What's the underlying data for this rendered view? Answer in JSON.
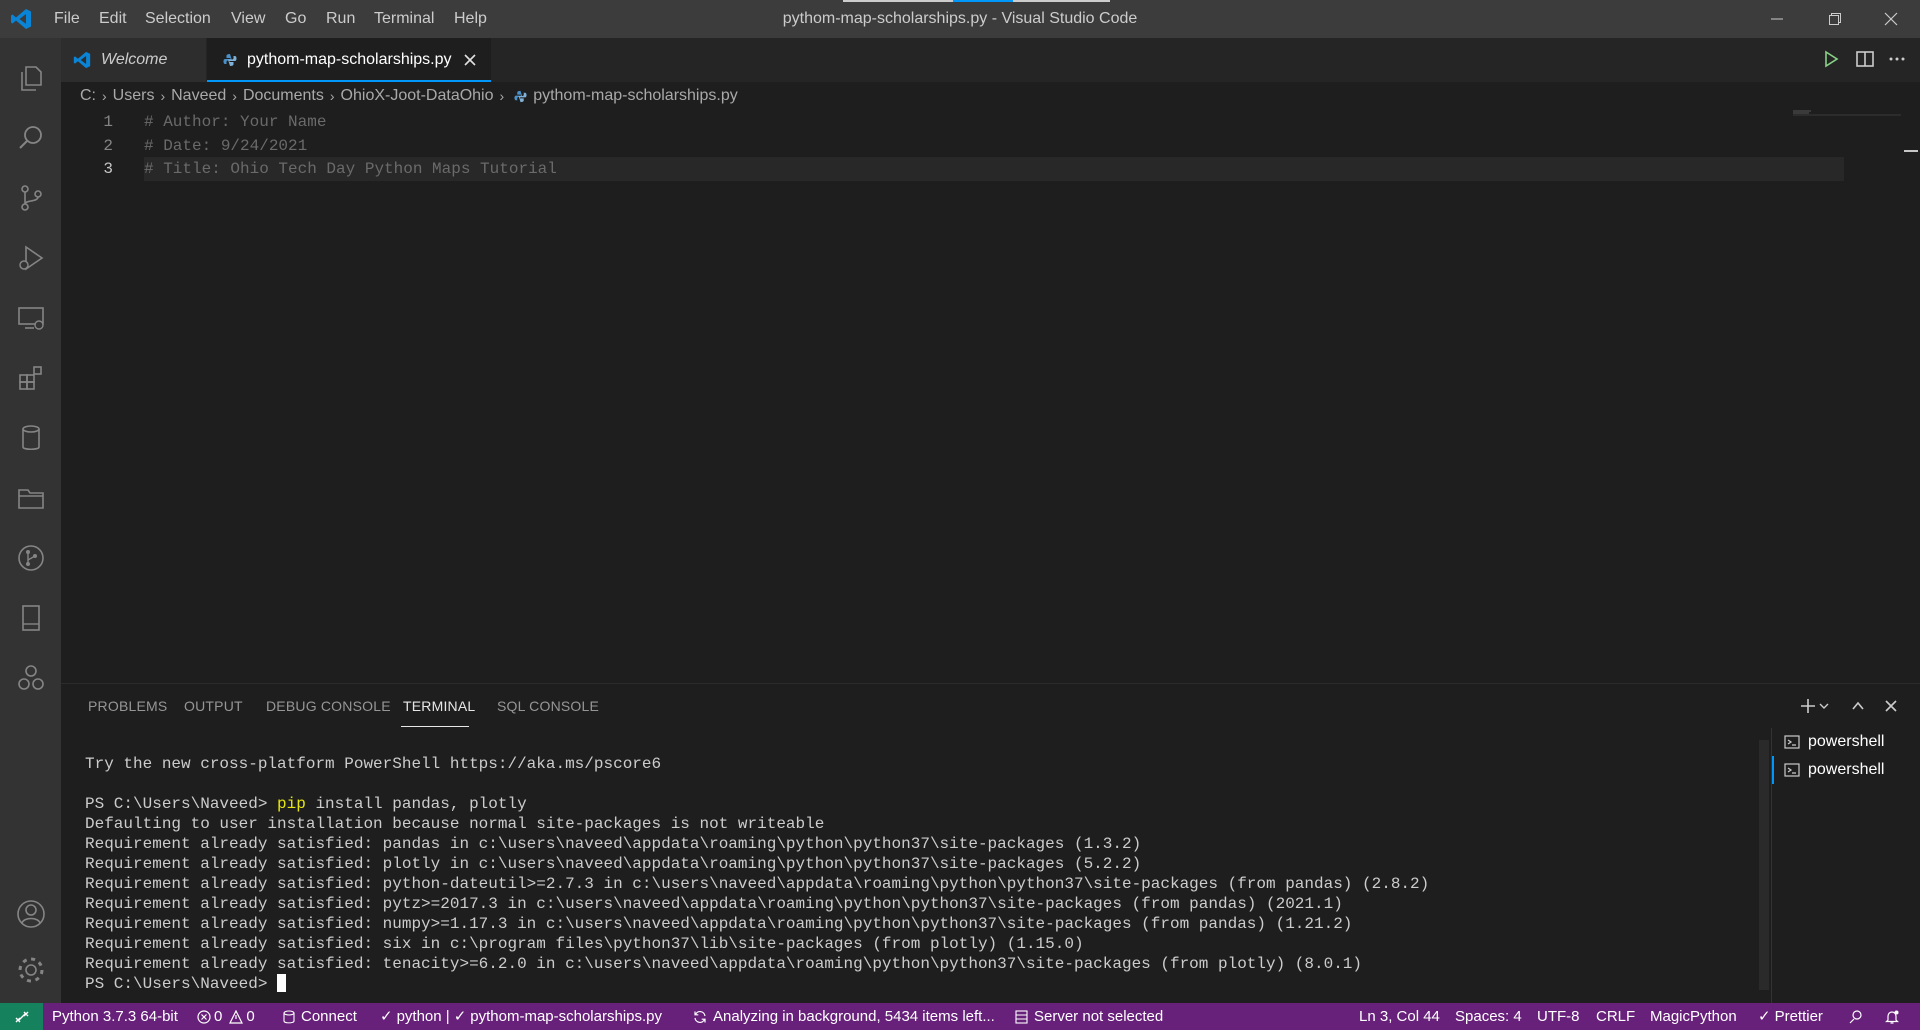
{
  "window": {
    "title": "pythom-map-scholarships.py - Visual Studio Code",
    "menu": [
      "File",
      "Edit",
      "Selection",
      "View",
      "Go",
      "Run",
      "Terminal",
      "Help"
    ]
  },
  "activity_bar": {
    "icons": [
      "files-icon",
      "search-icon",
      "source-control-icon",
      "run-debug-icon",
      "remote-explorer-icon",
      "extensions-icon",
      "database-icon",
      "folder-icon",
      "git-graph-icon",
      "notebook-icon",
      "live-share-icon"
    ],
    "bottom_icons": [
      "account-icon",
      "settings-gear-icon"
    ]
  },
  "tabs": {
    "welcome": "Welcome",
    "active": "pythom-map-scholarships.py"
  },
  "breadcrumbs": [
    "C:",
    "Users",
    "Naveed",
    "Documents",
    "OhioX-Joot-DataOhio",
    "pythom-map-scholarships.py"
  ],
  "editor": {
    "lines": [
      {
        "num": "1",
        "text": "# Author: Your Name"
      },
      {
        "num": "2",
        "text": "# Date: 9/24/2021"
      },
      {
        "num": "3",
        "text": "# Title: Ohio Tech Day Python Maps Tutorial"
      }
    ]
  },
  "panel": {
    "tabs": [
      "PROBLEMS",
      "OUTPUT",
      "DEBUG CONSOLE",
      "TERMINAL",
      "SQL CONSOLE"
    ],
    "active_tab": "TERMINAL",
    "terminals": [
      "powershell",
      "powershell"
    ],
    "terminal_lines": {
      "l1": "Try the new cross-platform PowerShell https://aka.ms/pscore6",
      "prompt1": "PS C:\\Users\\Naveed> ",
      "cmd_pip": "pip",
      "cmd_rest": " install pandas, plotly",
      "l3": "Defaulting to user installation because normal site-packages is not writeable",
      "l4": "Requirement already satisfied: pandas in c:\\users\\naveed\\appdata\\roaming\\python\\python37\\site-packages (1.3.2)",
      "l5": "Requirement already satisfied: plotly in c:\\users\\naveed\\appdata\\roaming\\python\\python37\\site-packages (5.2.2)",
      "l6": "Requirement already satisfied: python-dateutil>=2.7.3 in c:\\users\\naveed\\appdata\\roaming\\python\\python37\\site-packages (from pandas) (2.8.2)",
      "l7": "Requirement already satisfied: pytz>=2017.3 in c:\\users\\naveed\\appdata\\roaming\\python\\python37\\site-packages (from pandas) (2021.1)",
      "l8": "Requirement already satisfied: numpy>=1.17.3 in c:\\users\\naveed\\appdata\\roaming\\python\\python37\\site-packages (from pandas) (1.21.2)",
      "l9": "Requirement already satisfied: six in c:\\program files\\python37\\lib\\site-packages (from plotly) (1.15.0)",
      "l10": "Requirement already satisfied: tenacity>=6.2.0 in c:\\users\\naveed\\appdata\\roaming\\python\\python37\\site-packages (from plotly) (8.0.1)",
      "prompt2": "PS C:\\Users\\Naveed> "
    }
  },
  "status_bar": {
    "python": "Python 3.7.3 64-bit",
    "errors": "0",
    "warnings": "0",
    "connect": "Connect",
    "linter": "python | ",
    "linter_file": "pythom-map-scholarships.py",
    "analyzing": "Analyzing in background, 5434 items left...",
    "server": "Server not selected",
    "position": "Ln 3, Col 44",
    "spaces": "Spaces: 4",
    "encoding": "UTF-8",
    "eol": "CRLF",
    "language": "MagicPython",
    "prettier": "Prettier"
  },
  "colors": {
    "accent_blue": "#0097fb",
    "status_purple": "#68217a",
    "remote_green": "#16825d"
  }
}
